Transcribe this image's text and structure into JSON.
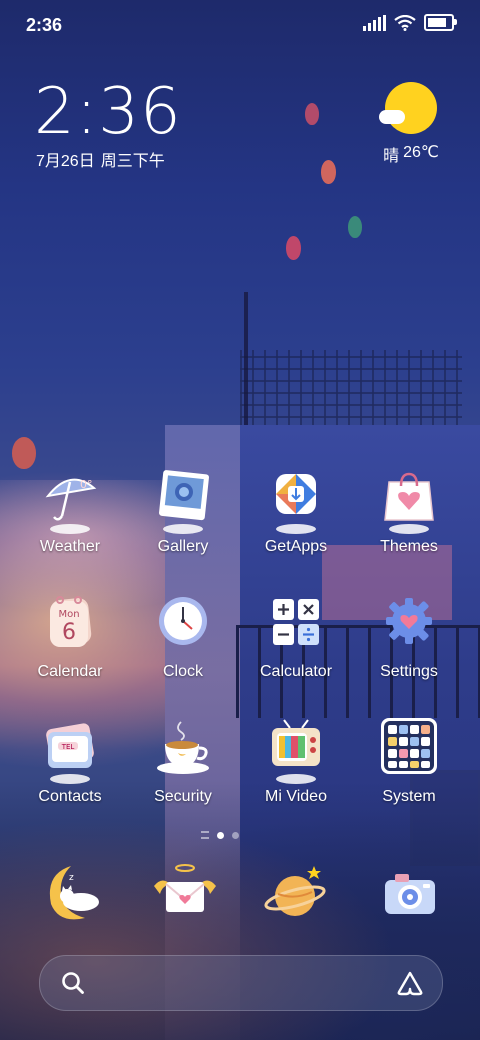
{
  "status_bar": {
    "time": "2:36",
    "icons": [
      "signal-icon",
      "wifi-icon",
      "battery-icon"
    ],
    "battery_level": 0.9
  },
  "clock_widget": {
    "time": "2:36",
    "date": "7月26日",
    "weekday": "周三",
    "period": "下午"
  },
  "weather_widget": {
    "icon": "sunny-icon",
    "condition": "晴",
    "temperature": "26℃"
  },
  "apps": [
    {
      "label": "Weather",
      "icon": "weather-umbrella-icon"
    },
    {
      "label": "Gallery",
      "icon": "gallery-photo-icon"
    },
    {
      "label": "GetApps",
      "icon": "getapps-download-icon"
    },
    {
      "label": "Themes",
      "icon": "themes-heart-bag-icon"
    },
    {
      "label": "Calendar",
      "icon": "calendar-icon",
      "day_abbr": "Mon",
      "day_num": "6"
    },
    {
      "label": "Clock",
      "icon": "clock-icon"
    },
    {
      "label": "Calculator",
      "icon": "calculator-icon"
    },
    {
      "label": "Settings",
      "icon": "settings-gear-icon"
    },
    {
      "label": "Contacts",
      "icon": "contacts-book-icon",
      "book_text": "TEL"
    },
    {
      "label": "Security",
      "icon": "security-coffee-icon"
    },
    {
      "label": "Mi Video",
      "icon": "mi-video-tv-icon"
    },
    {
      "label": "System",
      "icon": "system-folder-icon"
    }
  ],
  "page_indicator": {
    "pages": 2,
    "active": 1
  },
  "dock": [
    {
      "icon": "phone-moon-cat-icon"
    },
    {
      "icon": "messages-winged-envelope-icon"
    },
    {
      "icon": "browser-planet-icon"
    },
    {
      "icon": "camera-icon"
    }
  ],
  "search_bar": {
    "left_icon": "search-icon",
    "right_icon": "assistant-icon"
  },
  "colors": {
    "sky_top": "#1e2a6b",
    "sun": "#ffd21f",
    "text": "#ffffff"
  }
}
